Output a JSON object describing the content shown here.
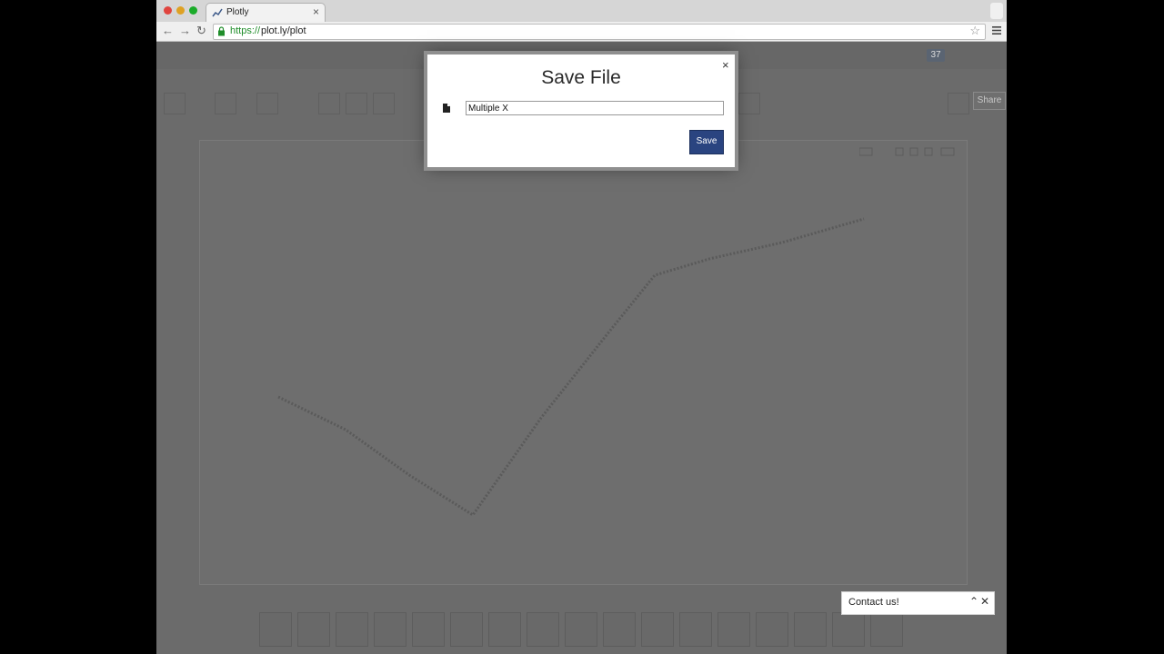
{
  "browser": {
    "tab_title": "Plotly",
    "url_scheme": "https://",
    "url_rest": "plot.ly/plot"
  },
  "app": {
    "notification_count": "37",
    "share_label": "Share",
    "contact_label": "Contact us!"
  },
  "modal": {
    "title": "Save File",
    "filename_value": "Multiple X",
    "save_label": "Save",
    "close_glyph": "×"
  },
  "colors": {
    "accent": "#2a4480",
    "https_green": "#1f8d2a"
  }
}
